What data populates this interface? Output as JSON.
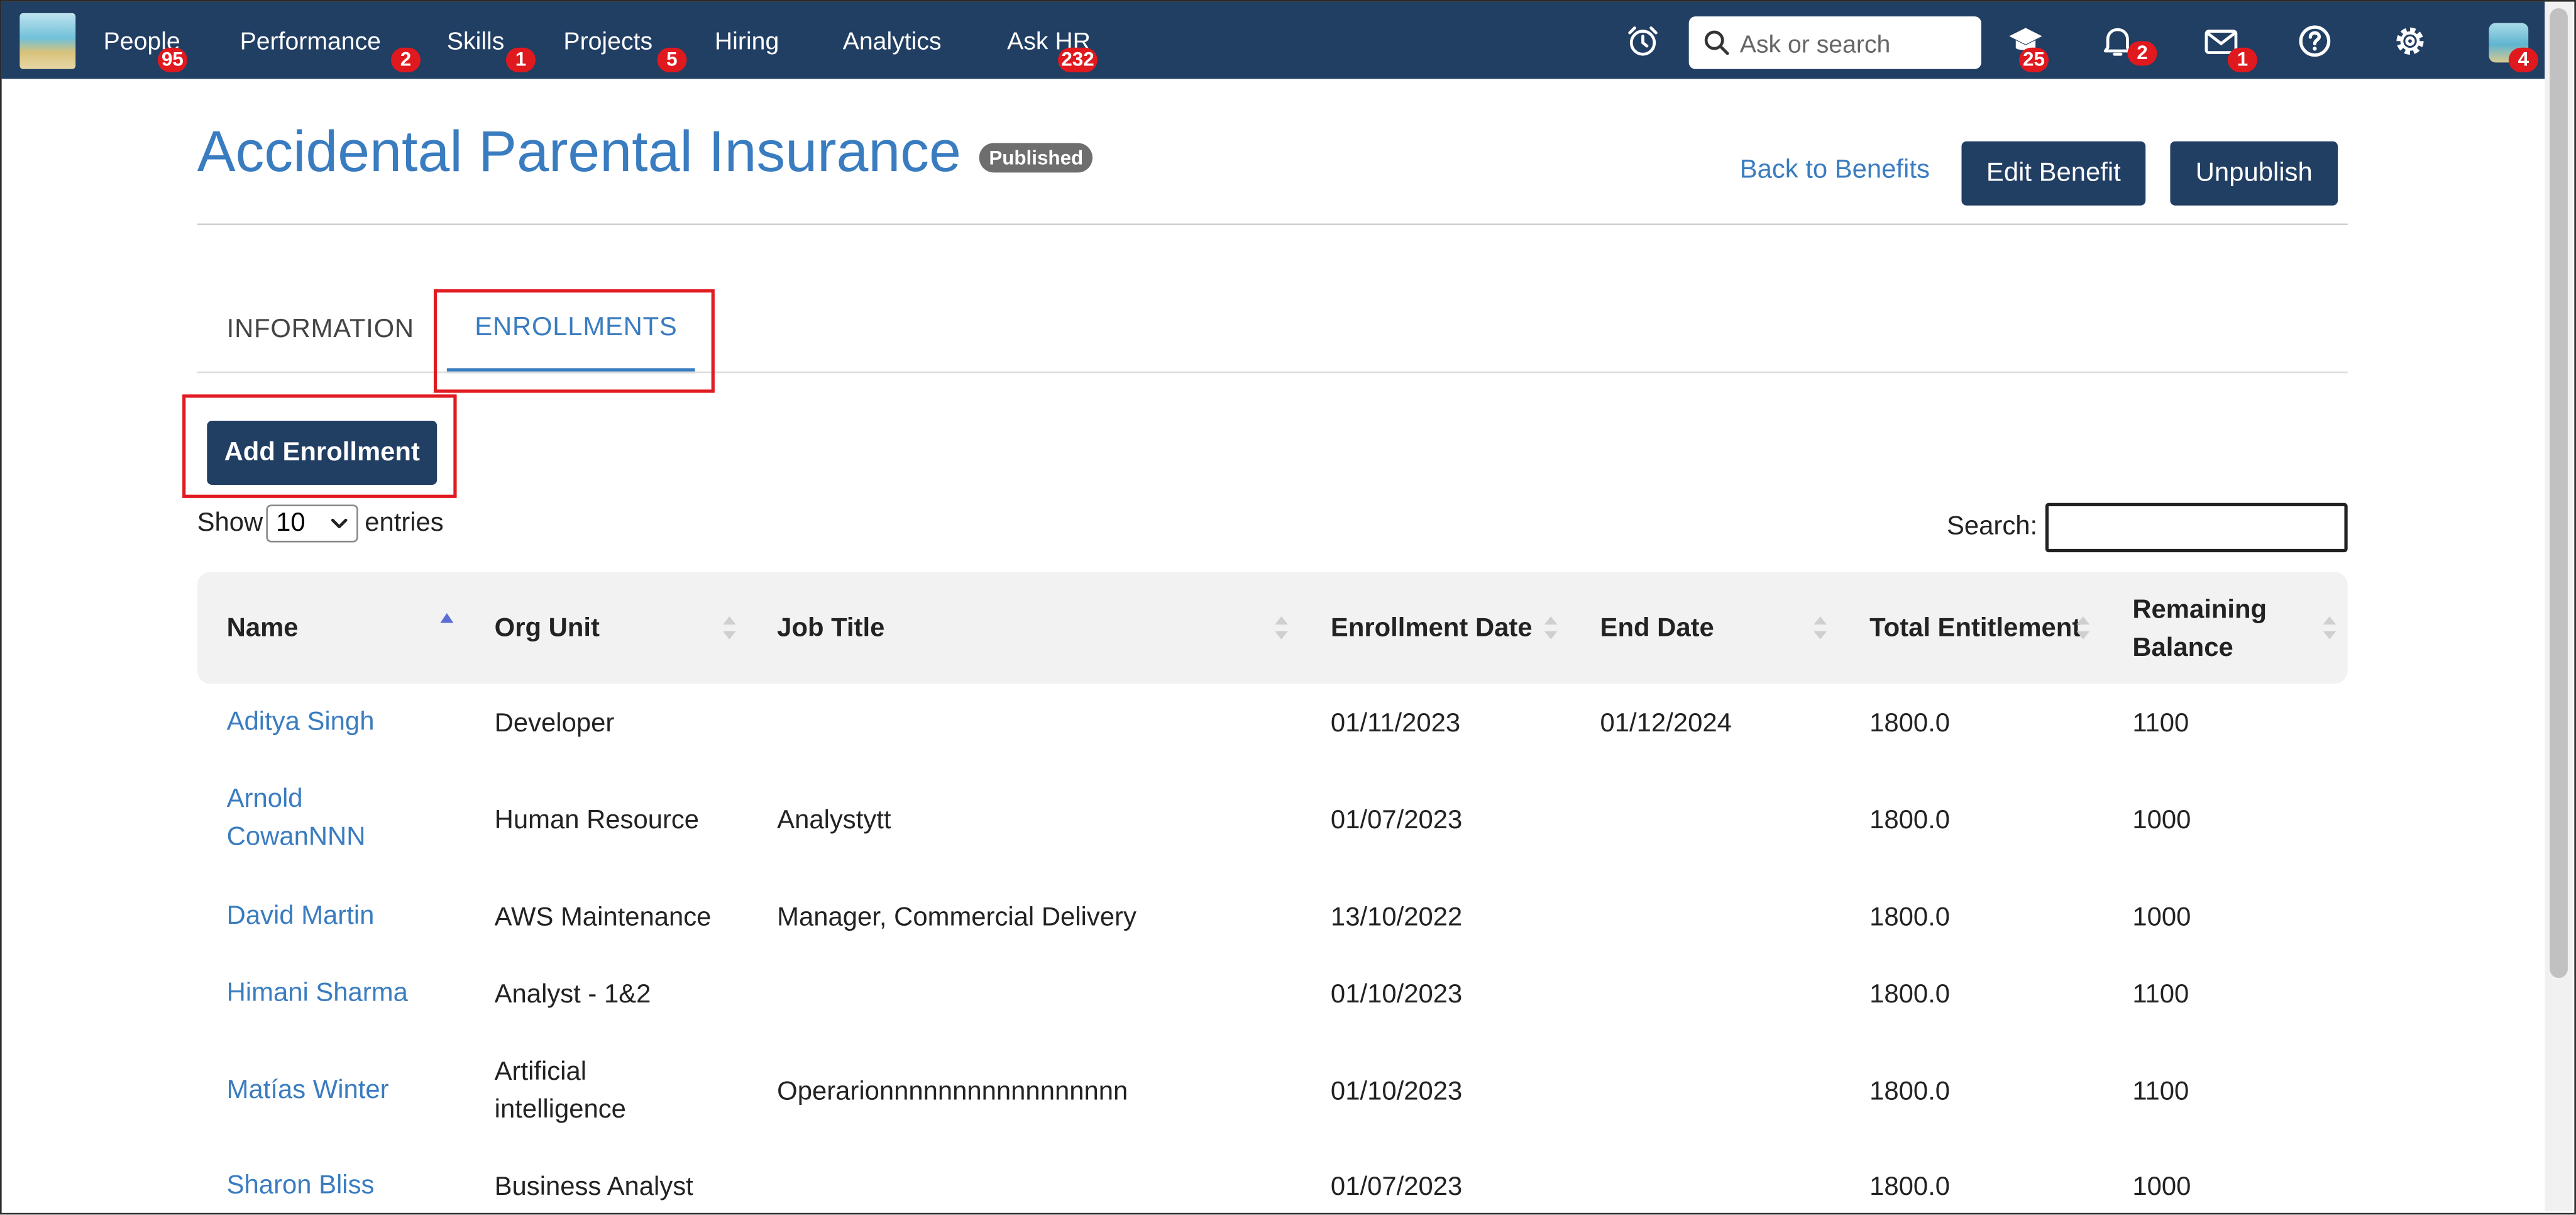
{
  "nav": {
    "items": [
      {
        "label": "People",
        "badge": "95"
      },
      {
        "label": "Performance",
        "badge": "2"
      },
      {
        "label": "Skills",
        "badge": "1"
      },
      {
        "label": "Projects",
        "badge": "5"
      },
      {
        "label": "Hiring",
        "badge": ""
      },
      {
        "label": "Analytics",
        "badge": ""
      },
      {
        "label": "Ask HR",
        "badge": "232"
      }
    ],
    "search_placeholder": "Ask or search",
    "icons": {
      "alarm": {
        "name": "alarm-clock-icon",
        "badge": ""
      },
      "learning": {
        "name": "graduation-cap-icon",
        "badge": "25"
      },
      "bell": {
        "name": "bell-icon",
        "badge": "2"
      },
      "mail": {
        "name": "mail-icon",
        "badge": "1"
      },
      "help": {
        "name": "help-icon",
        "badge": ""
      },
      "settings": {
        "name": "gear-icon",
        "badge": ""
      },
      "avatar": {
        "name": "avatar",
        "badge": "4"
      }
    }
  },
  "header": {
    "title": "Accidental Parental Insurance",
    "status": "Published",
    "back_link": "Back to Benefits",
    "edit_label": "Edit Benefit",
    "unpublish_label": "Unpublish"
  },
  "tabs": [
    {
      "label": "INFORMATION",
      "active": false
    },
    {
      "label": "ENROLLMENTS",
      "active": true
    }
  ],
  "toolbar": {
    "add_label": "Add Enrollment",
    "show_label": "Show",
    "page_size": "10",
    "entries_label": "entries",
    "search_label": "Search:",
    "search_value": ""
  },
  "table": {
    "headers": {
      "name": "Name",
      "org_unit": "Org Unit",
      "job_title": "Job Title",
      "enrollment_date": "Enrollment Date",
      "end_date": "End Date",
      "total_entitlement": "Total Entitlement",
      "remaining_line1": "Remaining",
      "remaining_line2": "Balance"
    },
    "rows": [
      {
        "name1": "Aditya Singh",
        "name2": "",
        "org1": "Developer",
        "org2": "",
        "job": "",
        "enroll": "01/11/2023",
        "end": "01/12/2024",
        "total": "1800.0",
        "remaining": "1100"
      },
      {
        "name1": "Arnold",
        "name2": "CowanNNN",
        "org1": "Human Resource",
        "org2": "",
        "job": "Analystytt",
        "enroll": "01/07/2023",
        "end": "",
        "total": "1800.0",
        "remaining": "1000"
      },
      {
        "name1": "David Martin",
        "name2": "",
        "org1": "AWS Maintenance",
        "org2": "",
        "job": "Manager, Commercial Delivery",
        "enroll": "13/10/2022",
        "end": "",
        "total": "1800.0",
        "remaining": "1000"
      },
      {
        "name1": "Himani Sharma",
        "name2": "",
        "org1": "Analyst - 1&2",
        "org2": "",
        "job": "",
        "enroll": "01/10/2023",
        "end": "",
        "total": "1800.0",
        "remaining": "1100"
      },
      {
        "name1": "Matías Winter",
        "name2": "",
        "org1": "Artificial",
        "org2": "intelligence",
        "job": "Operarionnnnnnnnnnnnnnnnn",
        "enroll": "01/10/2023",
        "end": "",
        "total": "1800.0",
        "remaining": "1100"
      },
      {
        "name1": "Sharon Bliss",
        "name2": "",
        "org1": "Business Analyst",
        "org2": "",
        "job": "",
        "enroll": "01/07/2023",
        "end": "",
        "total": "1800.0",
        "remaining": "1000"
      }
    ]
  },
  "colors": {
    "nav_bg": "#213e63",
    "accent": "#3a7cc0",
    "badge": "#e0191e",
    "highlight": "#e11b22"
  }
}
